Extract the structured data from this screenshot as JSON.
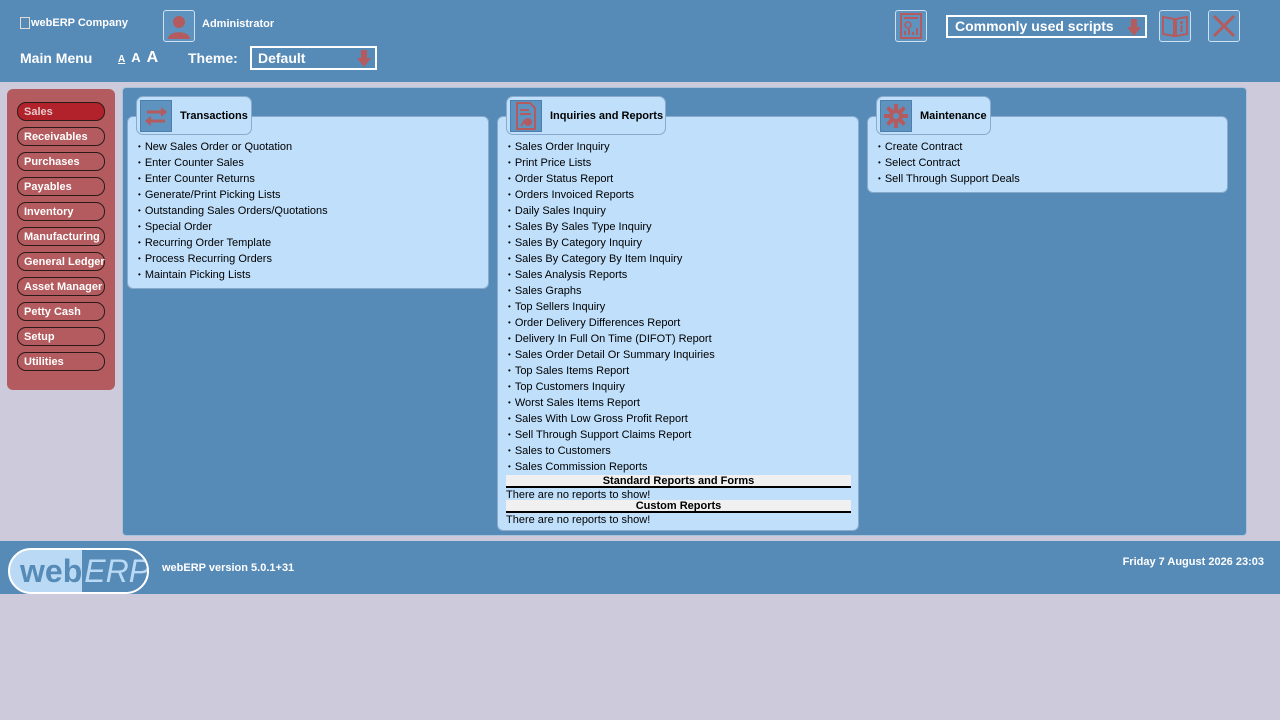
{
  "header": {
    "company": "webERP Company",
    "user": "Administrator",
    "main_menu": "Main Menu",
    "font_sizes": [
      "A",
      "A",
      "A"
    ],
    "theme_label": "Theme:",
    "theme_value": "Default",
    "scripts_select": "Commonly used scripts"
  },
  "sidebar": {
    "items": [
      {
        "label": "Sales",
        "active": true
      },
      {
        "label": "Receivables"
      },
      {
        "label": "Purchases"
      },
      {
        "label": "Payables"
      },
      {
        "label": "Inventory"
      },
      {
        "label": "Manufacturing"
      },
      {
        "label": "General Ledger"
      },
      {
        "label": "Asset Manager"
      },
      {
        "label": "Petty Cash"
      },
      {
        "label": "Setup"
      },
      {
        "label": "Utilities"
      }
    ]
  },
  "panels": {
    "transactions": {
      "title": "Transactions",
      "links": [
        "New Sales Order or Quotation",
        "Enter Counter Sales",
        "Enter Counter Returns",
        "Generate/Print Picking Lists",
        "Outstanding Sales Orders/Quotations",
        "Special Order",
        "Recurring Order Template",
        "Process Recurring Orders",
        "Maintain Picking Lists"
      ]
    },
    "inquiries": {
      "title": "Inquiries and Reports",
      "links": [
        "Sales Order Inquiry",
        "Print Price Lists",
        "Order Status Report",
        "Orders Invoiced Reports",
        "Daily Sales Inquiry",
        "Sales By Sales Type Inquiry",
        "Sales By Category Inquiry",
        "Sales By Category By Item Inquiry",
        "Sales Analysis Reports",
        "Sales Graphs",
        "Top Sellers Inquiry",
        "Order Delivery Differences Report",
        "Delivery In Full On Time (DIFOT) Report",
        "Sales Order Detail Or Summary Inquiries",
        "Top Sales Items Report",
        "Top Customers Inquiry",
        "Worst Sales Items Report",
        "Sales With Low Gross Profit Report",
        "Sell Through Support Claims Report",
        "Sales to Customers",
        "Sales Commission Reports"
      ],
      "standard_heading": "Standard Reports and Forms",
      "standard_empty": "There are no reports to show!",
      "custom_heading": "Custom Reports",
      "custom_empty": "There are no reports to show!"
    },
    "maintenance": {
      "title": "Maintenance",
      "links": [
        "Create Contract",
        "Select Contract",
        "Sell Through Support Deals"
      ]
    }
  },
  "footer": {
    "logo_web": "web",
    "logo_erp": "ERP",
    "version": "webERP version 5.0.1+31",
    "datetime": "Friday 7 August 2026 23:03"
  },
  "colors": {
    "header_bg": "#568ab7",
    "sidebar_bg": "#b35b5e",
    "sidebar_active": "#b2222b",
    "panel_bg": "#bfdffb",
    "page_bg": "#cdcbdb",
    "icon_red": "#b35b5e"
  },
  "icons": {
    "user": "user-icon",
    "dashboard": "dashboard-icon",
    "manual": "manual-book-icon",
    "logout": "close-icon",
    "transactions": "transfer-arrows-icon",
    "inquiries": "report-document-icon",
    "maintenance": "gear-icon"
  }
}
